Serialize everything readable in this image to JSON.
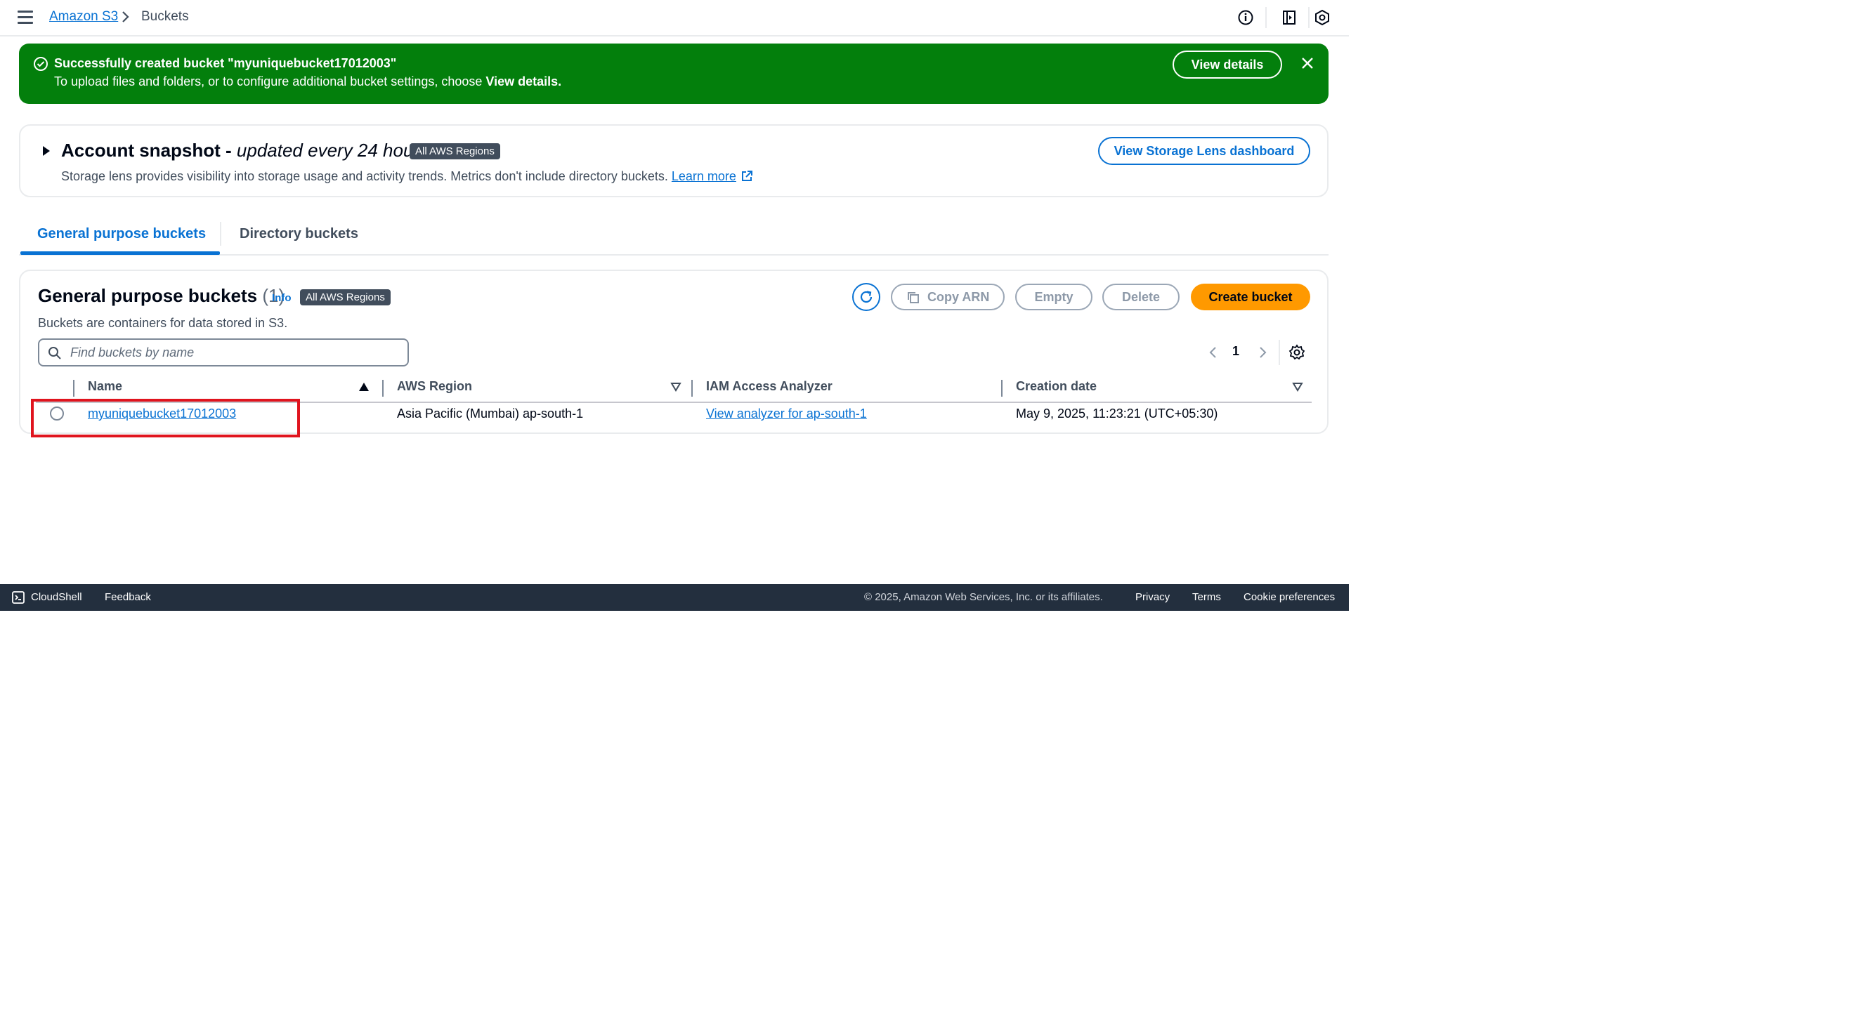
{
  "breadcrumb": {
    "root": "Amazon S3",
    "current": "Buckets"
  },
  "flash": {
    "title": "Successfully created bucket \"myuniquebucket17012003\"",
    "text_prefix": "To upload files and folders, or to configure additional bucket settings, choose",
    "text_bold": "View details.",
    "button": "View details",
    "color": "#037f0c"
  },
  "snapshot": {
    "title": "Account snapshot - ",
    "title_italic": "updated every 24 hours",
    "badge": "All AWS Regions",
    "description": "Storage lens provides visibility into storage usage and activity trends. Metrics don't include directory buckets.",
    "learn_more": "Learn more",
    "button": "View Storage Lens dashboard"
  },
  "tabs": [
    {
      "label": "General purpose buckets",
      "active": true
    },
    {
      "label": "Directory buckets",
      "active": false
    }
  ],
  "buckets": {
    "title": "General purpose buckets",
    "count": "(1)",
    "info": "Info",
    "badge": "All AWS Regions",
    "description": "Buckets are containers for data stored in S3.",
    "actions": {
      "copy_arn": "Copy ARN",
      "empty": "Empty",
      "delete": "Delete",
      "create": "Create bucket"
    },
    "search_placeholder": "Find buckets by name",
    "page": "1",
    "columns": [
      "Name",
      "AWS Region",
      "IAM Access Analyzer",
      "Creation date"
    ],
    "rows": [
      {
        "name": "myuniquebucket17012003",
        "region": "Asia Pacific (Mumbai) ap-south-1",
        "analyzer": "View analyzer for ap-south-1",
        "created": "May 9, 2025, 11:23:21 (UTC+05:30)"
      }
    ]
  },
  "footer": {
    "cloudshell": "CloudShell",
    "feedback": "Feedback",
    "copyright": "© 2025, Amazon Web Services, Inc. or its affiliates.",
    "privacy": "Privacy",
    "terms": "Terms",
    "cookies": "Cookie preferences"
  },
  "colors": {
    "accent": "#0972d3",
    "primary_button": "#ff9900",
    "footer": "#232f3e",
    "highlight": "#e0141e"
  },
  "icons": [
    "hamburger-icon",
    "chevron-right-icon",
    "info-circle-icon",
    "notebook-icon",
    "settings-hex-icon",
    "check-circle-icon",
    "close-icon",
    "caret-right-icon",
    "external-link-icon",
    "refresh-icon",
    "copy-icon",
    "search-icon",
    "chevron-left-icon",
    "gear-icon",
    "sort-ascending-icon",
    "sort-descending-icon",
    "cloudshell-icon"
  ]
}
